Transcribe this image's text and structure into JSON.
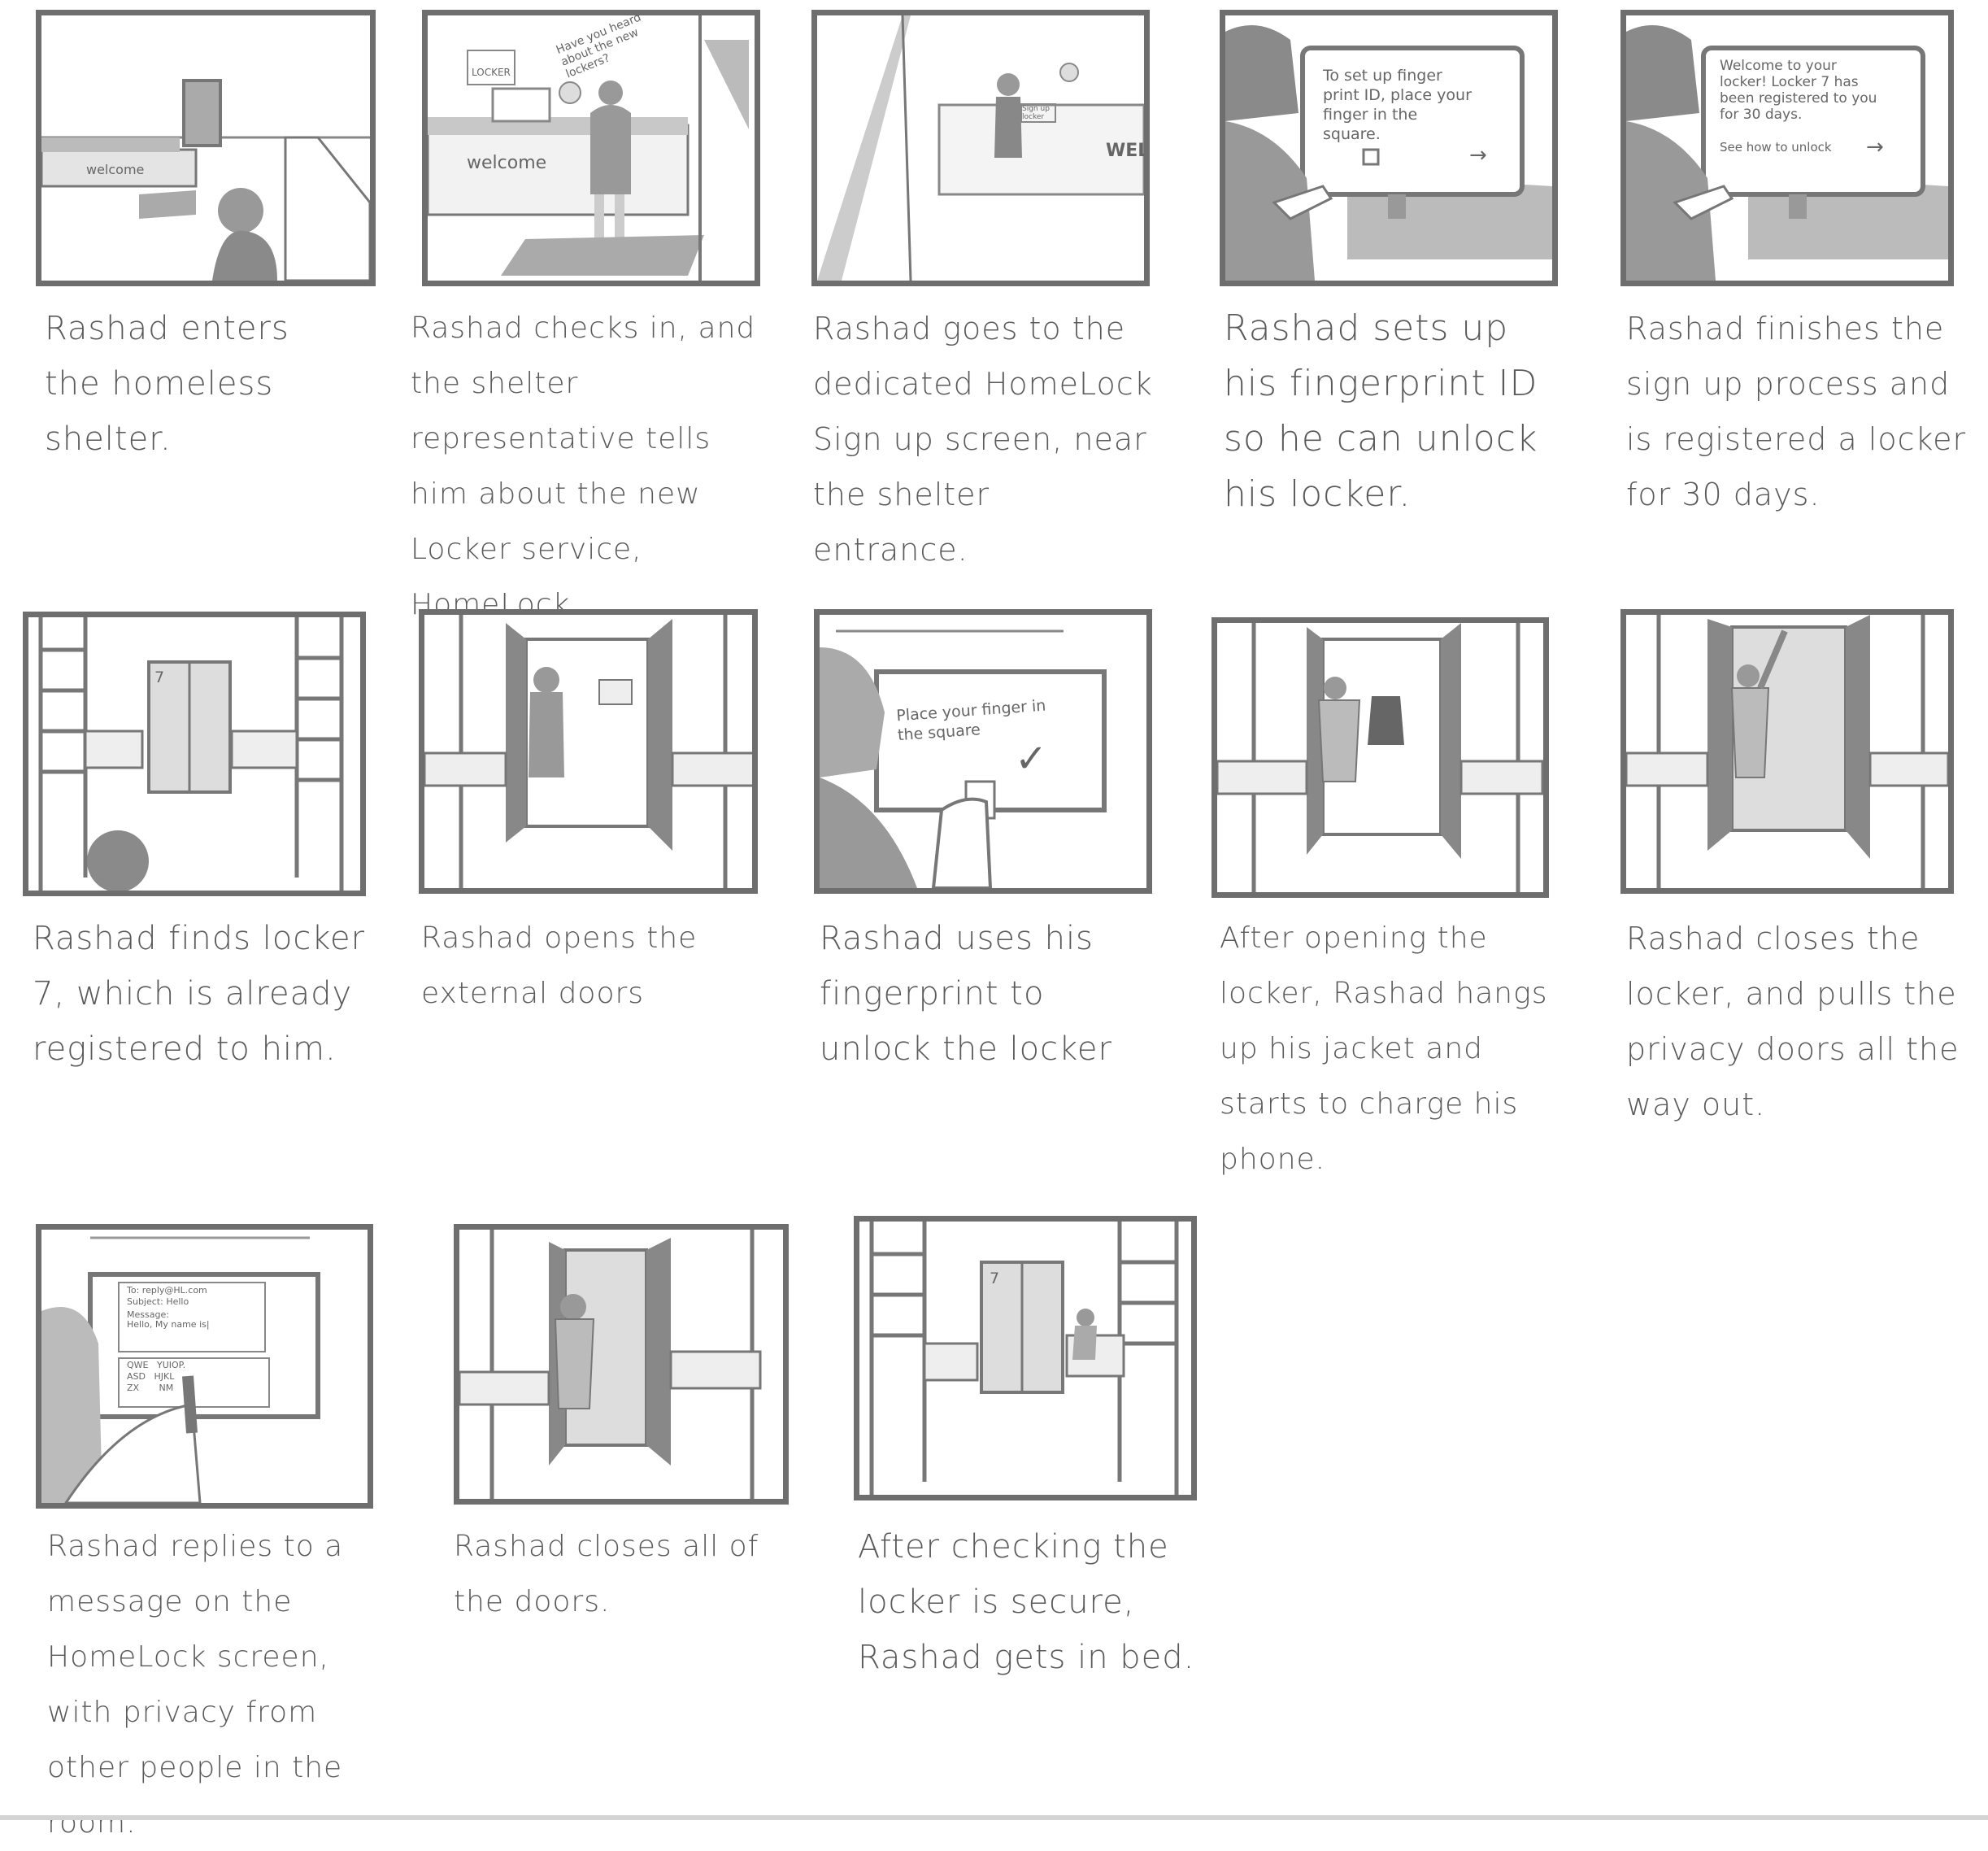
{
  "storyboard": {
    "panels": [
      {
        "caption": "Rashad enters the homeless shelter.",
        "scene_text": [
          "welcome"
        ]
      },
      {
        "caption": "Rashad checks in, and the shelter representative tells him about the new Locker service, HomeLock.",
        "scene_text": [
          "LOCKER",
          "Have you heard about the new lockers?",
          "welcome"
        ]
      },
      {
        "caption": "Rashad goes to the dedicated HomeLock Sign up screen, near the shelter entrance.",
        "scene_text": [
          "Sign up locker",
          "WEL"
        ]
      },
      {
        "caption": "Rashad sets up his fingerprint ID so he can unlock his locker.",
        "screen_text": "To set up finger print ID, place your finger in the square.",
        "arrow": "→"
      },
      {
        "caption": "Rashad finishes the sign up process and is registered a locker for 30 days.",
        "screen_text": "Welcome to your locker! Locker 7 has been registered to you for 30 days.",
        "screen_link": "See how to unlock",
        "arrow": "→"
      },
      {
        "caption": "Rashad finds locker 7, which is already registered to him.",
        "scene_text": [
          "7"
        ]
      },
      {
        "caption": "Rashad opens the external doors"
      },
      {
        "caption": "Rashad uses his fingerprint to unlock the locker",
        "screen_text": "Place your finger in the square",
        "check": "✓"
      },
      {
        "caption": "After opening the locker, Rashad hangs up his jacket and starts to charge his phone."
      },
      {
        "caption": "Rashad closes the locker, and pulls the privacy doors all the way out."
      },
      {
        "caption": "Rashad replies to a message on the HomeLock screen, with privacy from other people in the room.",
        "email": {
          "to": "To: reply@HL.com",
          "subject": "Subject: Hello",
          "message_label": "Message:",
          "message": "Hello, My name is|"
        },
        "keyboard": [
          "QWE   YUIOP.",
          "ASD   HJKL",
          "ZX       NM"
        ]
      },
      {
        "caption": "Rashad closes all of the doors."
      },
      {
        "caption": "After checking the locker is secure, Rashad gets in bed.",
        "scene_text": [
          "7"
        ]
      }
    ]
  }
}
